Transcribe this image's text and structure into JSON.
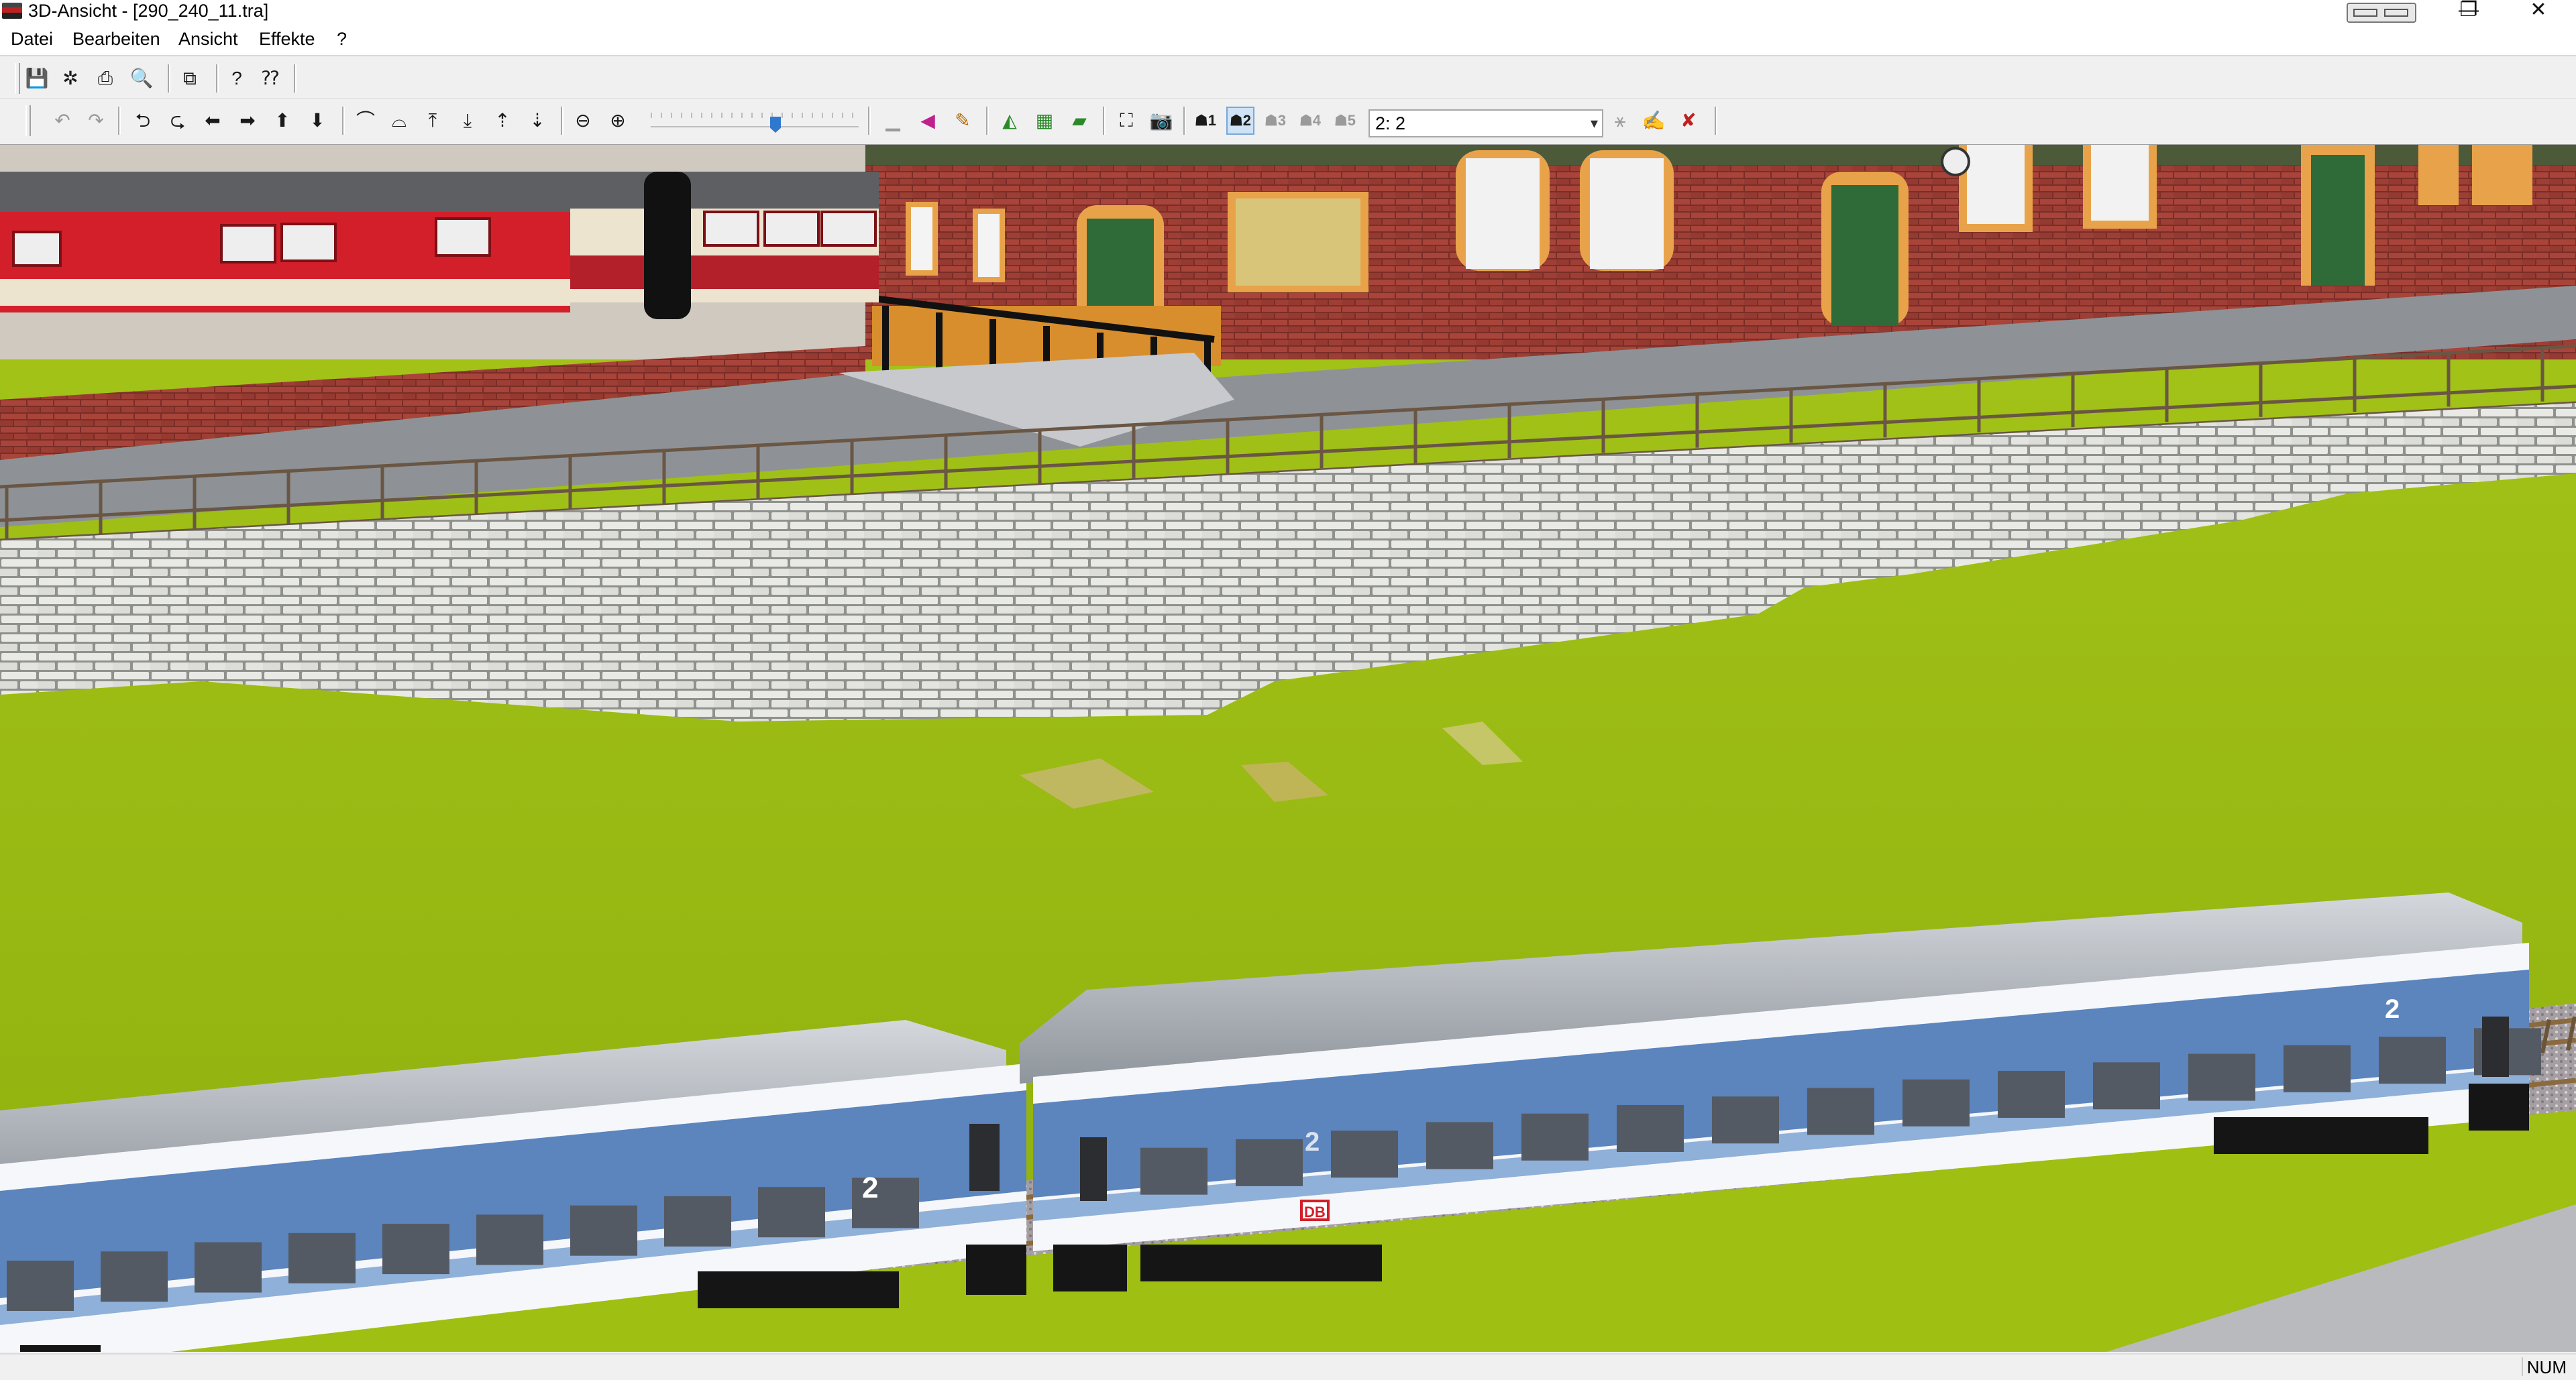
{
  "window": {
    "title": "3D-Ansicht - [290_240_11.tra]",
    "minimize_glyph": "—",
    "restore_glyph": "❐",
    "close_glyph": "✕"
  },
  "menu": {
    "items": [
      "Datei",
      "Bearbeiten",
      "Ansicht",
      "Effekte",
      "?"
    ]
  },
  "toolbar1": {
    "icons": [
      "save-icon",
      "camera-icon",
      "print-icon",
      "print-preview-icon",
      "copy-icon",
      "help-icon",
      "context-help-icon"
    ]
  },
  "toolbar2": {
    "zoom_level": 0.6,
    "view_select": {
      "value": "2: 2"
    },
    "camera_buttons": [
      {
        "label": "1",
        "active": false,
        "disabled": false
      },
      {
        "label": "2",
        "active": true,
        "disabled": false
      },
      {
        "label": "3",
        "active": false,
        "disabled": true
      },
      {
        "label": "4",
        "active": false,
        "disabled": true
      },
      {
        "label": "5",
        "active": false,
        "disabled": true
      }
    ]
  },
  "scene": {
    "coach_class_number": "2",
    "coach_logo": "DB",
    "colors": {
      "grass": "#9fbf12",
      "brick": "#9a3b32",
      "coach_blue": "#5c84bd",
      "coach_white": "#f5f7fa",
      "regional_red": "#d21f2a"
    }
  },
  "status": {
    "num": "NUM"
  }
}
